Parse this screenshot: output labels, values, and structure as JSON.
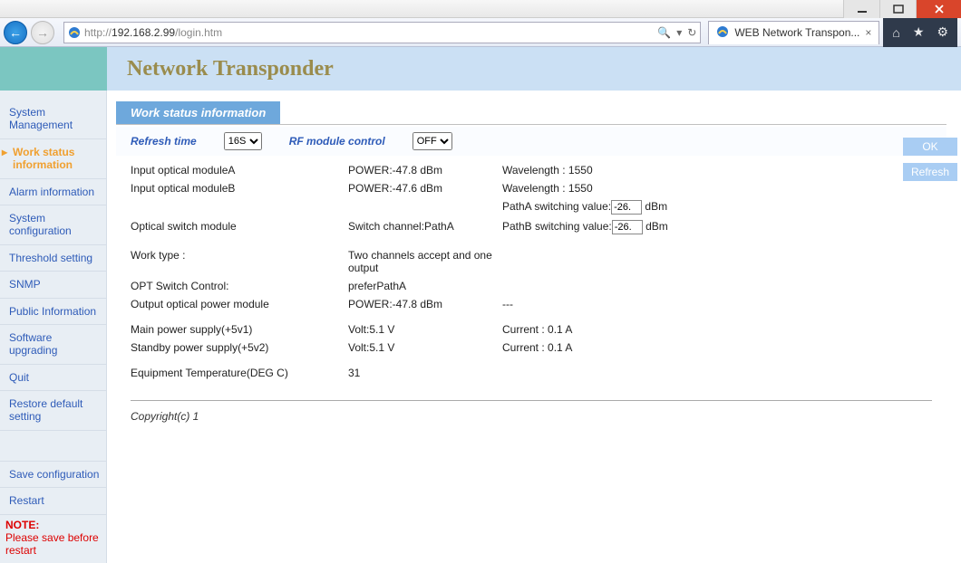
{
  "browser": {
    "url_prefix": "http://",
    "url_host": "192.168.2.99",
    "url_path": "/login.htm",
    "tab_title": "WEB Network Transpon...",
    "search_icon_label": "🔍",
    "refresh_icon_label": "↻",
    "home_icon": "⌂",
    "star_icon": "★",
    "gear_icon": "⚙"
  },
  "header": {
    "title": "Network Transponder"
  },
  "sidebar": {
    "items": [
      {
        "label": "System Management"
      },
      {
        "label": "Work status information",
        "active": true
      },
      {
        "label": "Alarm information"
      },
      {
        "label": "System configuration"
      },
      {
        "label": "Threshold setting"
      },
      {
        "label": "SNMP"
      },
      {
        "label": "Public Information"
      },
      {
        "label": "Software upgrading"
      },
      {
        "label": "Quit"
      },
      {
        "label": "Restore default setting"
      }
    ],
    "save_label": "Save configuration",
    "restart_label": "Restart",
    "note_title": "NOTE:",
    "note_text": "Please save before restart"
  },
  "subnav": {
    "active_tab": "Work status information"
  },
  "controls": {
    "refresh_label": "Refresh time",
    "refresh_value": "16S",
    "rf_label": "RF module control",
    "rf_value": "OFF"
  },
  "status": {
    "inA_label": "Input optical moduleA",
    "inA_power": "POWER:-47.8 dBm",
    "inA_wl": "Wavelength : 1550",
    "inB_label": "Input optical moduleB",
    "inB_power": "POWER:-47.6 dBm",
    "inB_wl": "Wavelength : 1550",
    "opt_sw_label": "Optical switch module",
    "opt_sw_val": "Switch channel:PathA",
    "pathA_label": "PathA switching value:",
    "pathA_val": "-26.",
    "pathA_unit": "dBm",
    "pathB_label": "PathB switching value:",
    "pathB_val": "-26.",
    "pathB_unit": "dBm",
    "work_type_label": "Work type :",
    "work_type_val": "Two channels accept and one output",
    "opt_ctrl_label": "OPT Switch Control:",
    "opt_ctrl_val": "preferPathA",
    "out_pwr_label": "Output optical power module",
    "out_pwr_val": "POWER:-47.8 dBm",
    "out_pwr_extra": "---",
    "main_ps_label": "Main power supply(+5v1)",
    "main_ps_v": "Volt:5.1 V",
    "main_ps_c": "Current : 0.1 A",
    "stby_ps_label": "Standby power supply(+5v2)",
    "stby_ps_v": "Volt:5.1 V",
    "stby_ps_c": "Current : 0.1 A",
    "temp_label": "Equipment Temperature(DEG C)",
    "temp_val": "31"
  },
  "actions": {
    "ok": "OK",
    "refresh": "Refresh"
  },
  "footer": {
    "copyright": "Copyright(c) 1"
  }
}
